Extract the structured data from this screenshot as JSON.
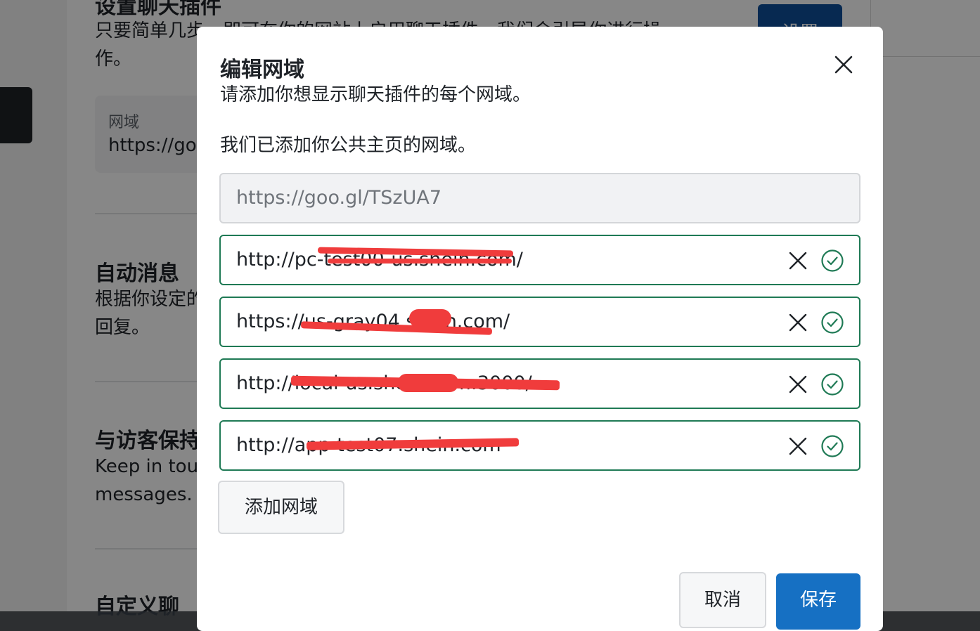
{
  "background": {
    "setup": {
      "title": "设置聊天插件",
      "desc_line1": "只要简单几步，即可在你的网站上启用聊天插件，我们会引导你进行操",
      "desc_line2": "作。",
      "domain_label": "网域",
      "domain_value": "https://go",
      "button": "设置"
    },
    "auto_message": {
      "title": "自动消息",
      "desc_line1": "根据你设定的",
      "desc_line2": "回复。"
    },
    "keep_in_touch": {
      "title": "与访客保持",
      "desc_line1": "Keep in tou",
      "desc_line2": "messages."
    },
    "customize": {
      "title": "自定义聊"
    }
  },
  "modal": {
    "title": "编辑网域",
    "description": "请添加你想显示聊天插件的每个网域。",
    "note": "我们已添加你公共主页的网域。",
    "readonly_domain": "https://goo.gl/TSzUA7",
    "domains": [
      {
        "value": "http://pc-test00-us.shein.com/"
      },
      {
        "value": "https://us-gray04.shein.com/"
      },
      {
        "value": "http://local-us.shein.com:3000/"
      },
      {
        "value": "http://app-test07.shein.com"
      }
    ],
    "add_button": "添加网域",
    "cancel_button": "取消",
    "save_button": "保存"
  },
  "colors": {
    "accent": "#1670c3",
    "valid_border": "#1f7a55",
    "redaction": "#f03c3c"
  },
  "icons": {
    "close": "close-icon",
    "clear": "clear-icon",
    "valid": "check-circle-icon"
  }
}
